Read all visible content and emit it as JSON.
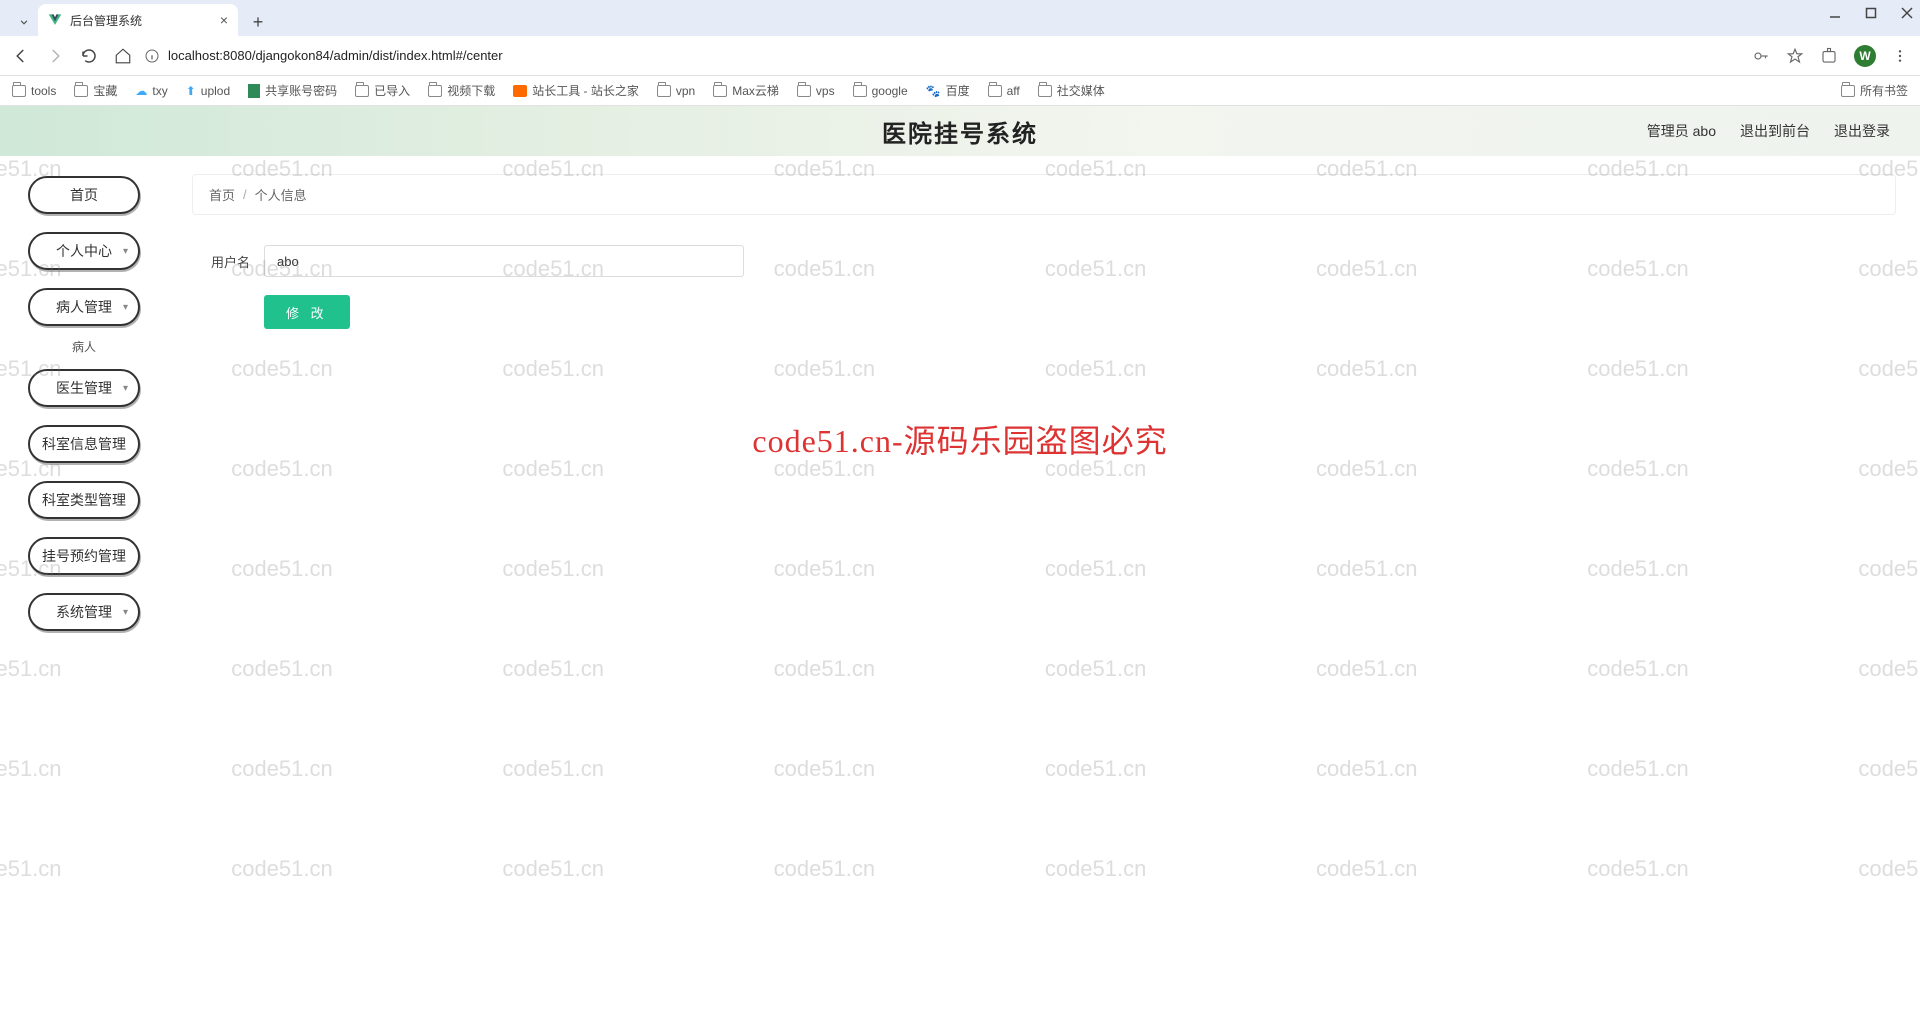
{
  "browser": {
    "tab_title": "后台管理系统",
    "url_display": "localhost:8080/djangokon84/admin/dist/index.html#/center",
    "avatar_initial": "W",
    "bookmarks": [
      "tools",
      "宝藏",
      "txy",
      "uplod",
      "共享账号密码",
      "已导入",
      "视频下载",
      "站长工具 - 站长之家",
      "vpn",
      "Max云梯",
      "vps",
      "google",
      "百度",
      "aff",
      "社交媒体"
    ],
    "all_bookmarks_label": "所有书签"
  },
  "header": {
    "title": "医院挂号系统",
    "user_label": "管理员 abo",
    "to_front_label": "退出到前台",
    "logout_label": "退出登录"
  },
  "sidebar": {
    "items": [
      {
        "label": "首页",
        "expandable": false
      },
      {
        "label": "个人中心",
        "expandable": true
      },
      {
        "label": "病人管理",
        "expandable": true,
        "sub": "病人"
      },
      {
        "label": "医生管理",
        "expandable": true
      },
      {
        "label": "科室信息管理",
        "expandable": false
      },
      {
        "label": "科室类型管理",
        "expandable": false
      },
      {
        "label": "挂号预约管理",
        "expandable": false
      },
      {
        "label": "系统管理",
        "expandable": true
      }
    ]
  },
  "breadcrumb": {
    "home": "首页",
    "current": "个人信息"
  },
  "form": {
    "username_label": "用户名",
    "username_value": "abo",
    "submit_label": "修 改"
  },
  "watermark": {
    "text": "code51.cn",
    "center_text": "code51.cn-源码乐园盗图必究"
  }
}
